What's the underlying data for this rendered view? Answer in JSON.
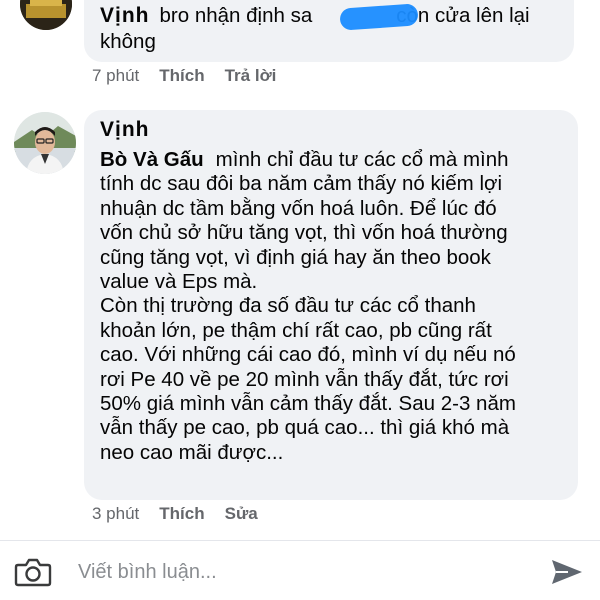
{
  "comments": [
    {
      "author": "Vịnh",
      "line1": "bro nhận định sa",
      "line1_tail": "còn cửa lên lại",
      "line2": "không",
      "time": "7 phút",
      "like_label": "Thích",
      "reply_label": "Trả lời"
    },
    {
      "author": "Vịnh",
      "mention": "Bò Và Gấu",
      "lines": [
        "mình chỉ đầu tư các cổ mà mình",
        "tính dc sau đôi ba năm cảm thấy nó kiếm lợi",
        "nhuận dc tầm bằng vốn hoá luôn. Để lúc đó",
        "vốn chủ sở hữu tăng vọt, thì vốn hoá thường",
        "cũng tăng vọt, vì định giá hay ăn theo book",
        "value và Eps mà.",
        "Còn thị trường đa số đầu tư các cổ thanh",
        "khoản lớn, pe thậm chí rất cao, pb cũng rất",
        "cao. Với những cái cao đó, mình ví dụ nếu nó",
        "rơi Pe 40 về pe 20 mình vẫn thấy đắt, tức rơi",
        "50% giá mình vẫn cảm thấy đắt. Sau 2-3 năm",
        "vẫn thấy pe cao, pb quá cao... thì giá khó mà",
        "neo cao mãi được..."
      ],
      "time": "3 phút",
      "like_label": "Thích",
      "edit_label": "Sửa"
    }
  ],
  "composer": {
    "placeholder": "Viết bình luận...",
    "camera_icon": "camera-icon",
    "send_icon": "send-icon"
  },
  "colors": {
    "bubble": "#f0f2f5",
    "meta_text": "#65676b",
    "scribble": "#1a8cff"
  }
}
